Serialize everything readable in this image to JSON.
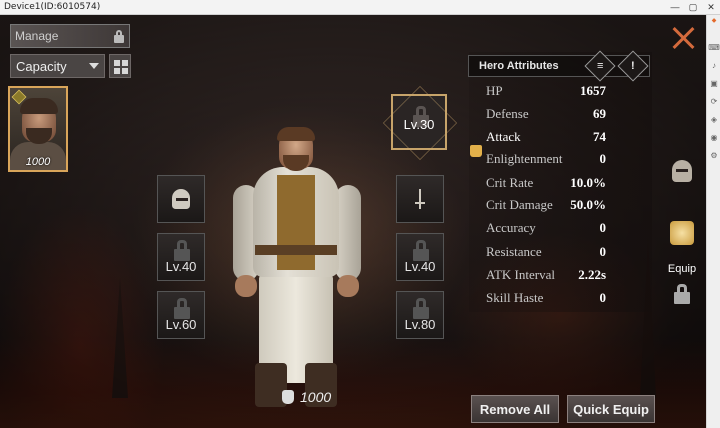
{
  "window": {
    "title": "Device1(ID:6010574)",
    "controls": [
      "—",
      "▢",
      "✕"
    ]
  },
  "left_panel": {
    "manage_label": "Manage",
    "capacity_label": "Capacity",
    "hero_card": {
      "power": "1000"
    }
  },
  "slots": {
    "main_level": "Lv.30",
    "left": [
      {
        "icon": "helmet-icon",
        "level": ""
      },
      {
        "icon": "lock-icon",
        "level": "Lv.40"
      },
      {
        "icon": "lock-icon",
        "level": "Lv.60"
      }
    ],
    "right": [
      {
        "icon": "sword-icon",
        "level": ""
      },
      {
        "icon": "lock-icon",
        "level": "Lv.40"
      },
      {
        "icon": "lock-icon",
        "level": "Lv.80"
      }
    ]
  },
  "hero_power": "1000",
  "attributes": {
    "header": "Hero Attributes",
    "alert_symbol": "!",
    "rows": [
      {
        "label": "HP",
        "value": "1657"
      },
      {
        "label": "Defense",
        "value": "69"
      },
      {
        "label": "Attack",
        "value": "74"
      },
      {
        "label": "Enlightenment",
        "value": "0"
      },
      {
        "label": "Crit Rate",
        "value": "10.0%"
      },
      {
        "label": "Crit Damage",
        "value": "50.0%"
      },
      {
        "label": "Accuracy",
        "value": "0"
      },
      {
        "label": "Resistance",
        "value": "0"
      },
      {
        "label": "ATK Interval",
        "value": "2.22s"
      },
      {
        "label": "Skill Haste",
        "value": "0"
      }
    ]
  },
  "side_menu": {
    "equip_label": "Equip"
  },
  "buttons": {
    "remove_all": "Remove All",
    "quick_equip": "Quick Equip"
  },
  "colors": {
    "accent_gold": "#c7a46a",
    "close_orange": "#d46a3c",
    "highlight": "#e2b04a"
  }
}
